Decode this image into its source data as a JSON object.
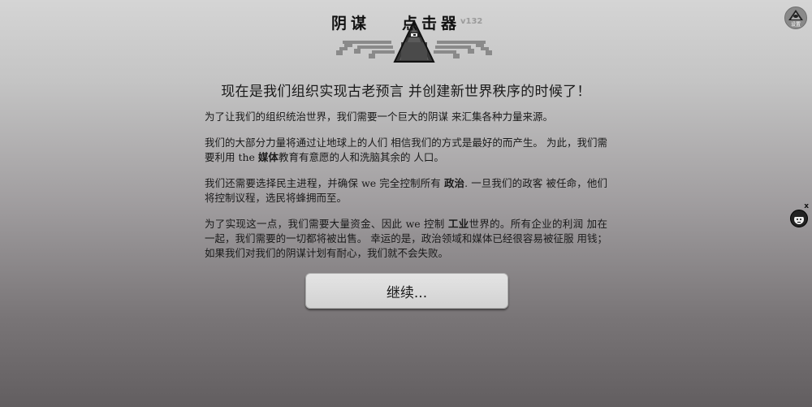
{
  "header": {
    "title_left": "阴谋",
    "title_right": "点击器",
    "version": "v132"
  },
  "settings": {
    "label": "设置"
  },
  "story": {
    "headline": "现在是我们组织实现古老预言 并创建新世界秩序的时候了！",
    "p1": "为了让我们的组织统治世界，我们需要一个巨大的阴谋 来汇集各种力量来源。",
    "p2_a": "我们的大部分力量将通过让地球上的人们 相信我们的方式是最好的而产生。 为此，我们需要利用 the ",
    "p2_b": "媒体",
    "p2_c": "教育有意愿的人和洗脑其余的 人口。",
    "p3_a": "我们还需要选择民主进程，并确保 we 完全控制所有 ",
    "p3_b": "政治",
    "p3_c": ". 一旦我们的政客 被任命，他们将控制议程，选民将蜂拥而至。",
    "p4_a": "为了实现这一点，我们需要大量资金、因此 we 控制 ",
    "p4_b": "工业",
    "p4_c": "世界的。所有企业的利润 加在一起，我们需要的一切都将被出售。 幸运的是，政治领域和媒体已经很容易被征服 用钱；如果我们对我们的阴谋计划有耐心，我们就不会失败。"
  },
  "buttons": {
    "continue": "继续..."
  },
  "side": {
    "close": "x"
  }
}
